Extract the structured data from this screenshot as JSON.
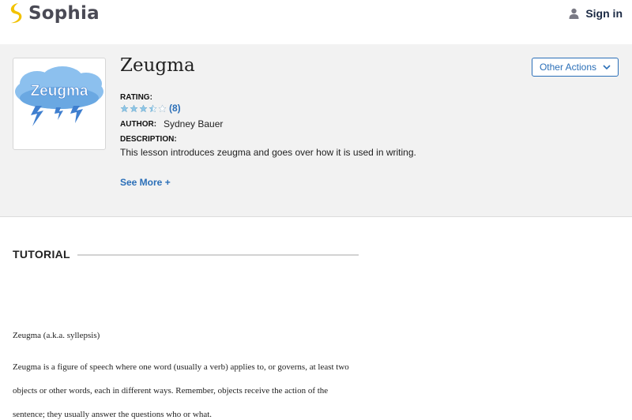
{
  "header": {
    "brand": "Sophia",
    "signin_label": "Sign in"
  },
  "lesson": {
    "thumbnail_text": "Zeugma",
    "title": "Zeugma",
    "rating_label": "RATING:",
    "rating_value": 3.5,
    "rating_max": 5,
    "rating_count": "(8)",
    "author_label": "AUTHOR:",
    "author": "Sydney Bauer",
    "description_label": "DESCRIPTION:",
    "description": "This lesson introduces zeugma and goes over how it is used in writing.",
    "see_more": "See More +",
    "other_actions": "Other Actions"
  },
  "tutorial": {
    "heading": "TUTORIAL",
    "paragraphs": [
      "Zeugma (a.k.a. syllepsis)",
      "Zeugma is a figure of speech where one word (usually a verb) applies to, or governs, at least two",
      "objects or other words, each in different ways. Remember, objects receive the action of the",
      "sentence; they usually answer the questions who or what."
    ]
  },
  "colors": {
    "accent": "#2b6fb8",
    "star": "#8ec6e6",
    "logo": "#f2c200",
    "cloud": "#7fb6ea"
  }
}
